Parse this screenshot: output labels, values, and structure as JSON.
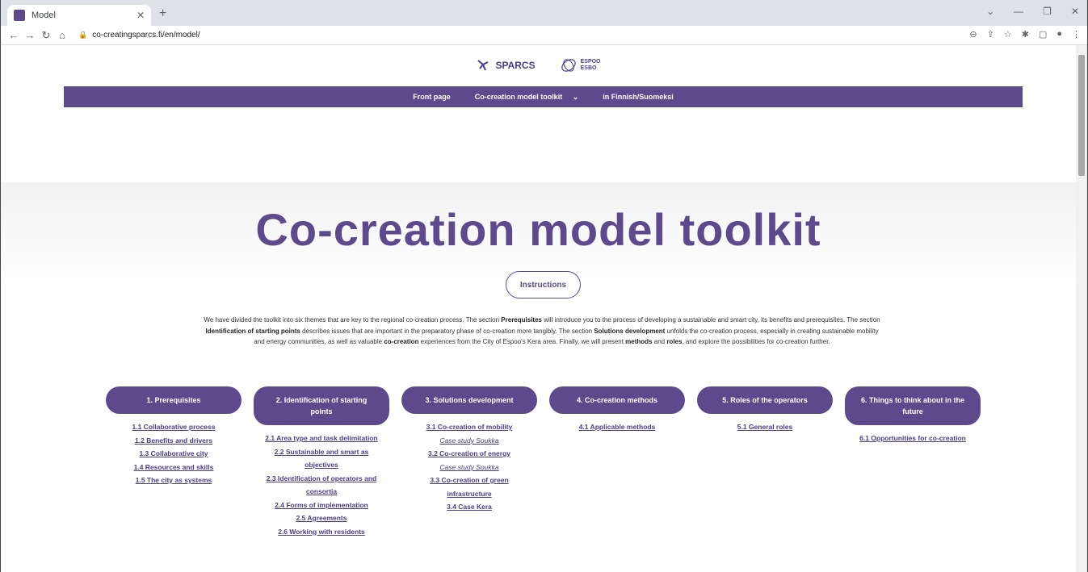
{
  "browser": {
    "tab_title": "Model",
    "url": "co-creatingsparcs.fi/en/model/"
  },
  "logos": {
    "sparcs": "SPARCS",
    "espoo_top": "ESPOO",
    "espoo_bottom": "ESBO"
  },
  "nav": {
    "items": [
      "Front page",
      "Co-creation model toolkit",
      "in Finnish/Suomeksi"
    ]
  },
  "hero": {
    "title": "Co-creation model toolkit",
    "instructions_label": "Instructions"
  },
  "intro": {
    "p1": "We have divided the toolkit into six themes that are key to the regional co-creation process. The section ",
    "b1": "Prerequisites",
    "p2": " will introduce you to the process of developing a sustainable and smart city, its benefits and prerequisites. The section ",
    "b2": "Identification of starting points",
    "p3": " describes issues that are important in the preparatory phase of co-creation more tangibly. The section ",
    "b3": "Solutions development",
    "p4": " unfolds the co-creation process, especially in creating sustainable mobility and energy communities, as well as valuable ",
    "b4": "co-creation",
    "p5": " experiences from the City of Espoo's Kera area. Finally, we will present ",
    "b5": "methods",
    "p6": " and ",
    "b6": "roles",
    "p7": ", and explore the possibilities for co-creation further."
  },
  "themes": [
    {
      "label": "1. Prerequisites",
      "links": [
        "1.1 Collaborative process",
        "1.2 Benefits and drivers",
        "1.3 Collaborative city",
        "1.4 Resources and skills",
        "1.5 The city as systems"
      ]
    },
    {
      "label": "2. Identification of starting points",
      "links": [
        "2.1 Area type and task delimitation",
        "2.2 Sustainable and smart as objectives",
        "2.3 Identification of operators and consortia",
        "2.4 Forms of implementation",
        "2.5 Agreements",
        "2.6 Working with residents"
      ]
    },
    {
      "label": "3. Solutions development",
      "links": [
        "3.1 Co-creation of mobility",
        "Case study Soukka",
        "3.2 Co-creation of energy",
        "Case study Soukka",
        "3.3 Co-creation of green infrastructure",
        "3.4 Case Kera"
      ]
    },
    {
      "label": "4. Co-creation methods",
      "links": [
        "4.1 Applicable methods"
      ]
    },
    {
      "label": "5. Roles of the operators",
      "links": [
        "5.1 General roles"
      ]
    },
    {
      "label": "6. Things to think about in the future",
      "links": [
        "6.1 Opportunities for co-creation"
      ]
    }
  ]
}
